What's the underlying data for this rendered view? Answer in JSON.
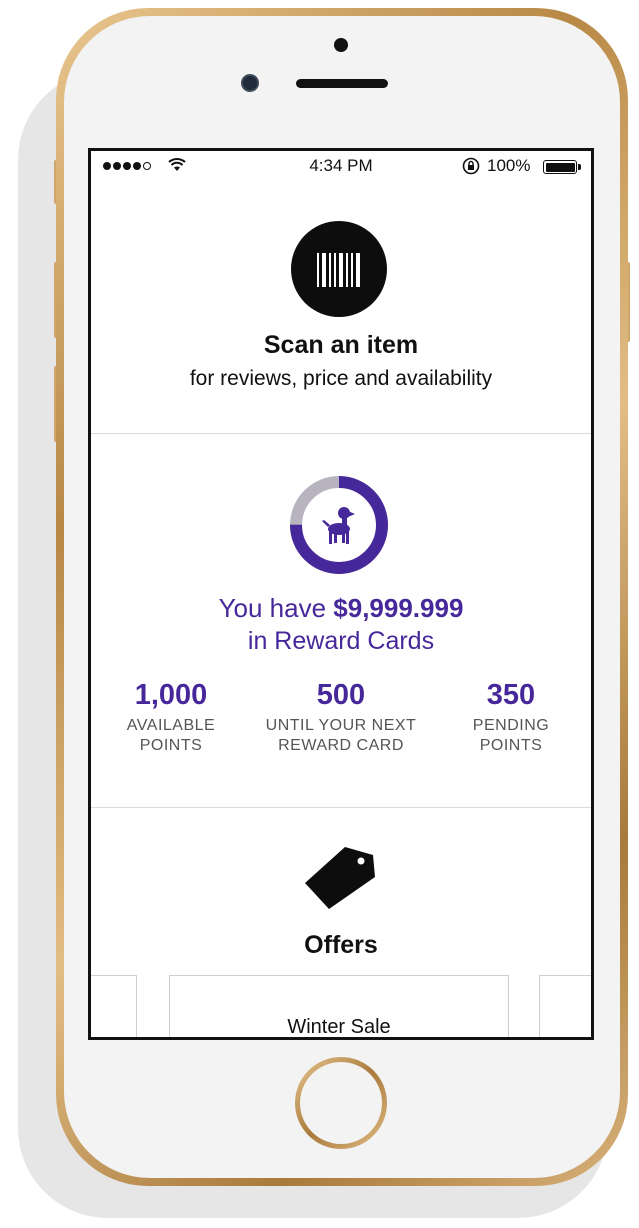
{
  "status_bar": {
    "time": "4:34 PM",
    "battery": "100%",
    "icons": [
      "signal-dots",
      "wifi-icon",
      "rotation-lock-icon",
      "battery-icon"
    ]
  },
  "scan": {
    "icon": "barcode-icon",
    "title": "Scan an item",
    "subtitle": "for reviews, price and availability"
  },
  "rewards": {
    "icon": "dog-icon",
    "progress_fraction": 0.75,
    "line1_prefix": "You have ",
    "amount": "$9,999.999",
    "line2": "in Reward Cards",
    "stats": [
      {
        "value": "1,000",
        "label1": "AVAILABLE",
        "label2": "POINTS"
      },
      {
        "value": "500",
        "label1": "UNTIL YOUR NEXT",
        "label2": "REWARD CARD"
      },
      {
        "value": "350",
        "label1": "PENDING",
        "label2": "POINTS"
      }
    ],
    "colors": {
      "accent": "#47289a",
      "track": "#b7b3bf"
    }
  },
  "offers": {
    "icon": "price-tag-icon",
    "title": "Offers",
    "cards": [
      {
        "label": ""
      },
      {
        "label": "Winter Sale"
      },
      {
        "label": ""
      }
    ]
  }
}
